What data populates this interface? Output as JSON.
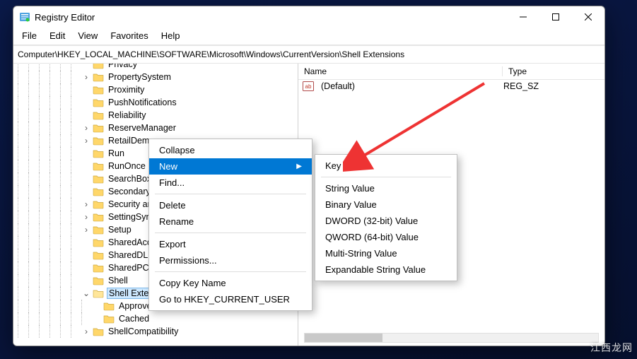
{
  "window": {
    "title": "Registry Editor"
  },
  "menubar": [
    "File",
    "Edit",
    "View",
    "Favorites",
    "Help"
  ],
  "address": "Computer\\HKEY_LOCAL_MACHINE\\SOFTWARE\\Microsoft\\Windows\\CurrentVersion\\Shell Extensions",
  "tree": {
    "items": [
      {
        "label": "Privacy",
        "indent": 6,
        "exp": ""
      },
      {
        "label": "PropertySystem",
        "indent": 6,
        "exp": ">"
      },
      {
        "label": "Proximity",
        "indent": 6,
        "exp": ""
      },
      {
        "label": "PushNotifications",
        "indent": 6,
        "exp": ""
      },
      {
        "label": "Reliability",
        "indent": 6,
        "exp": ""
      },
      {
        "label": "ReserveManager",
        "indent": 6,
        "exp": ">"
      },
      {
        "label": "RetailDemo",
        "indent": 6,
        "exp": ">"
      },
      {
        "label": "Run",
        "indent": 6,
        "exp": ""
      },
      {
        "label": "RunOnce",
        "indent": 6,
        "exp": ""
      },
      {
        "label": "SearchBox",
        "indent": 6,
        "exp": ""
      },
      {
        "label": "SecondaryAuth",
        "indent": 6,
        "exp": ""
      },
      {
        "label": "Security and Maintenance",
        "indent": 6,
        "exp": ">"
      },
      {
        "label": "SettingSync",
        "indent": 6,
        "exp": ">"
      },
      {
        "label": "Setup",
        "indent": 6,
        "exp": ">"
      },
      {
        "label": "SharedAccess",
        "indent": 6,
        "exp": ""
      },
      {
        "label": "SharedDLLs",
        "indent": 6,
        "exp": ""
      },
      {
        "label": "SharedPC",
        "indent": 6,
        "exp": ""
      },
      {
        "label": "Shell",
        "indent": 6,
        "exp": ""
      },
      {
        "label": "Shell Extensions",
        "indent": 6,
        "exp": "v",
        "selected": true
      },
      {
        "label": "Approved",
        "indent": 7,
        "exp": ""
      },
      {
        "label": "Cached",
        "indent": 7,
        "exp": ""
      },
      {
        "label": "ShellCompatibility",
        "indent": 6,
        "exp": ">"
      }
    ]
  },
  "list": {
    "headers": {
      "name": "Name",
      "type": "Type"
    },
    "rows": [
      {
        "name": "(Default)",
        "type": "REG_SZ"
      }
    ]
  },
  "ctx1": {
    "items": [
      {
        "label": "Collapse"
      },
      {
        "label": "New",
        "sub": true,
        "highlight": true
      },
      {
        "label": "Find..."
      },
      {
        "sep": true
      },
      {
        "label": "Delete"
      },
      {
        "label": "Rename"
      },
      {
        "sep": true
      },
      {
        "label": "Export"
      },
      {
        "label": "Permissions..."
      },
      {
        "sep": true
      },
      {
        "label": "Copy Key Name"
      },
      {
        "label": "Go to HKEY_CURRENT_USER"
      }
    ]
  },
  "ctx2": {
    "items": [
      {
        "label": "Key"
      },
      {
        "sep": true
      },
      {
        "label": "String Value"
      },
      {
        "label": "Binary Value"
      },
      {
        "label": "DWORD (32-bit) Value"
      },
      {
        "label": "QWORD (64-bit) Value"
      },
      {
        "label": "Multi-String Value"
      },
      {
        "label": "Expandable String Value"
      }
    ]
  },
  "watermark": "江西龙网"
}
